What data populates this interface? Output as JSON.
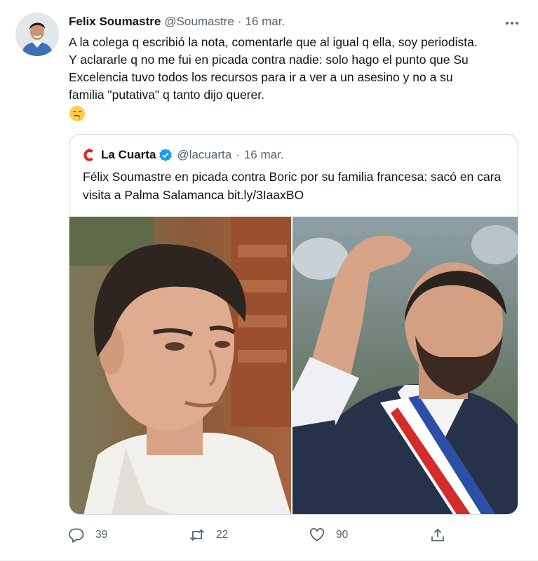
{
  "tweet": {
    "author_name": "Felix Soumastre",
    "author_handle": "@Soumastre",
    "separator": "·",
    "timestamp": "16 mar.",
    "text": "A la colega q escribió la nota, comentarle que al igual q ella, soy periodista.\nY aclararle q no me fui en picada contra nadie: solo hago el punto que Su\nExcelencia tuvo todos los recursos para ir a ver a un asesino y no a su\nfamilia \"putativa\" q tanto dijo querer.",
    "emoji": "drooling-face-emoji"
  },
  "quoted": {
    "author_name": "La Cuarta",
    "author_handle": "@lacuarta",
    "separator": "·",
    "timestamp": "16 mar.",
    "text": "Félix Soumastre en picada contra Boric por su familia francesa: sacó en cara visita a Palma Salamanca bit.ly/3IaaxBO",
    "verified": true,
    "logo_color": "#e2231a",
    "verified_color": "#1d9bf0"
  },
  "actions": {
    "reply_count": "39",
    "retweet_count": "22",
    "like_count": "90"
  },
  "colors": {
    "text_primary": "#0f1419",
    "text_secondary": "#536471",
    "border": "#cfd9de"
  }
}
